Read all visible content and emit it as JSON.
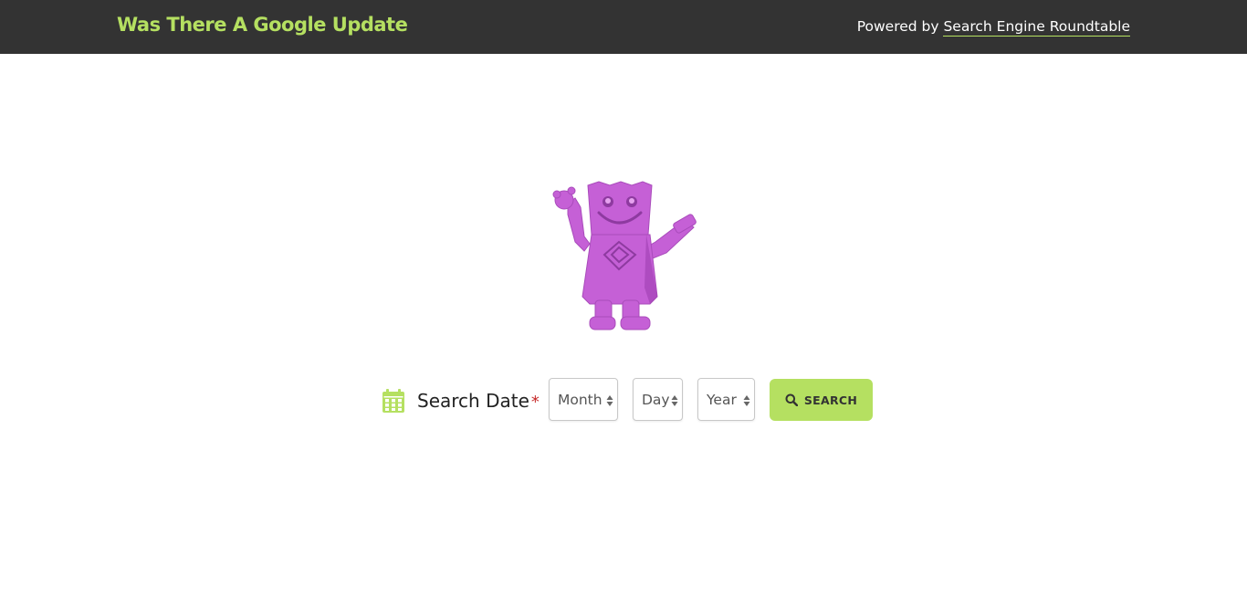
{
  "header": {
    "site_title": "Was There A Google Update",
    "powered_prefix": "Powered by ",
    "powered_link": "Search Engine Roundtable"
  },
  "colors": {
    "accent": "#b5e061",
    "topbar": "#333333",
    "required": "#c62828",
    "mascot": "#c560d6"
  },
  "form": {
    "label": "Search Date",
    "required_mark": "*",
    "calendar_icon": "calendar-icon",
    "month": {
      "selected": "Month"
    },
    "day": {
      "selected": "Day"
    },
    "year": {
      "selected": "Year"
    },
    "search_icon": "search-icon",
    "search_label": "SEARCH"
  }
}
